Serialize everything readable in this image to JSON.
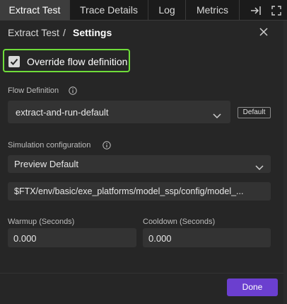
{
  "tabs": [
    {
      "label": "Extract Test",
      "active": true
    },
    {
      "label": "Trace Details",
      "active": false
    },
    {
      "label": "Log",
      "active": false
    },
    {
      "label": "Metrics",
      "active": false
    }
  ],
  "tab_icons": [
    "collapse-right-icon",
    "fullscreen-icon"
  ],
  "header": {
    "parent": "Extract Test",
    "separator": "/",
    "current": "Settings"
  },
  "override": {
    "label": "Override flow definition",
    "checked": true
  },
  "flow_definition": {
    "label": "Flow Definition",
    "value": "extract-and-run-default",
    "badge": "Default"
  },
  "simulation": {
    "label": "Simulation configuration",
    "value": "Preview Default",
    "path": "$FTX/env/basic/exe_platforms/model_ssp/config/model_..."
  },
  "warmup": {
    "label": "Warmup (Seconds)",
    "value": "0.000"
  },
  "cooldown": {
    "label": "Cooldown (Seconds)",
    "value": "0.000"
  },
  "footer": {
    "done_label": "Done"
  },
  "colors": {
    "accent": "#6b3fcf",
    "highlight": "#6fdd3a"
  }
}
